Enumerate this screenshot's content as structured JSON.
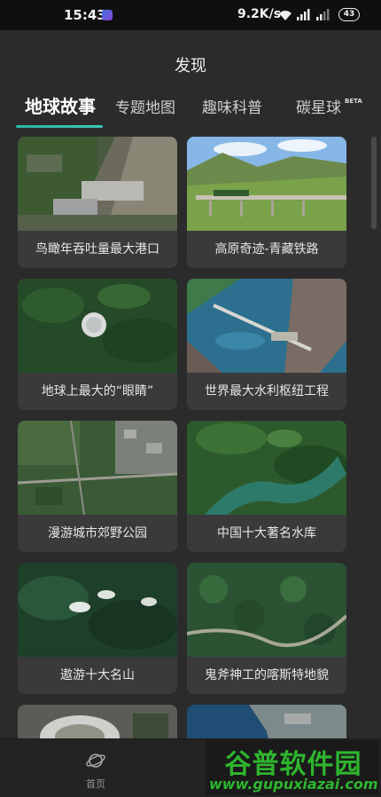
{
  "status_bar": {
    "time": "15:43",
    "network_speed": "9.2K/s",
    "battery": "43"
  },
  "page": {
    "title": "发现"
  },
  "tabs": [
    {
      "label": "地球故事",
      "active": true
    },
    {
      "label": "专题地图",
      "active": false
    },
    {
      "label": "趣味科普",
      "active": false
    },
    {
      "label": "碳星球",
      "active": false,
      "badge": "BETA"
    }
  ],
  "cards": [
    {
      "label": "鸟瞰年吞吐量最大港口"
    },
    {
      "label": "高原奇迹-青藏铁路"
    },
    {
      "label": "地球上最大的“眼睛”"
    },
    {
      "label": "世界最大水利枢纽工程"
    },
    {
      "label": "漫游城市郊野公园"
    },
    {
      "label": "中国十大著名水库"
    },
    {
      "label": "遨游十大名山"
    },
    {
      "label": "鬼斧神工的喀斯特地貌"
    }
  ],
  "bottom_nav": {
    "home_label": "首页",
    "home_icon": "planet-icon"
  },
  "watermark": {
    "title": "谷普软件园",
    "url": "www.gupuxiazai.com"
  },
  "colors": {
    "accent": "#2bb6a8",
    "background": "#2b2b2b",
    "card_background": "#3a3a3a"
  }
}
